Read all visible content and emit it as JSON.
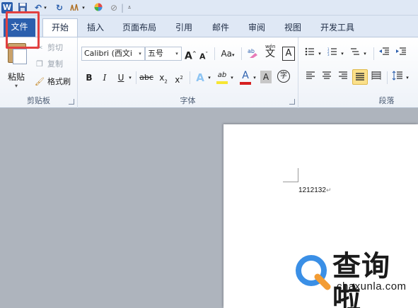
{
  "colors": {
    "file_tab": "#2b5fad",
    "ribbon_bg": "#ffffff",
    "workspace": "#aeb4bd",
    "highlight_box": "#e24040",
    "font_color_bar": "#d62020",
    "highlight_yellow": "#f7e633",
    "logo_blue": "#3a8fe6",
    "logo_orange": "#f39c33"
  },
  "qat": {
    "icons": [
      "word-app-icon",
      "save-icon",
      "undo-icon",
      "redo-icon",
      "format-painter-icon",
      "color-icon",
      "draw-icon",
      "customize-icon"
    ]
  },
  "tabs": [
    {
      "label": "文件"
    },
    {
      "label": "开始"
    },
    {
      "label": "插入"
    },
    {
      "label": "页面布局"
    },
    {
      "label": "引用"
    },
    {
      "label": "邮件"
    },
    {
      "label": "审阅"
    },
    {
      "label": "视图"
    },
    {
      "label": "开发工具"
    }
  ],
  "clipboard": {
    "paste": "粘贴",
    "cut": "剪切",
    "copy": "复制",
    "format_painter": "格式刷",
    "group_label": "剪贴板"
  },
  "font": {
    "name": "Calibri (西文i",
    "size": "五号",
    "grow": "A",
    "shrink": "A",
    "change_case": "Aa",
    "bold": "B",
    "italic": "I",
    "underline": "U",
    "strike": "abc",
    "subscript": "x",
    "superscript": "x",
    "sub_mark": "2",
    "sup_mark": "2",
    "text_effect": "A",
    "highlight": "ab",
    "font_color": "A",
    "char_shading": "A",
    "enclose": "字",
    "phonetic_top": "wén",
    "phonetic": "文",
    "char_border": "A",
    "group_label": "字体"
  },
  "paragraph": {
    "group_label": "段落"
  },
  "document": {
    "text": "1212132",
    "para_mark": "↵"
  },
  "watermark": {
    "brand": "查询啦",
    "url": "chaxunla.com"
  }
}
